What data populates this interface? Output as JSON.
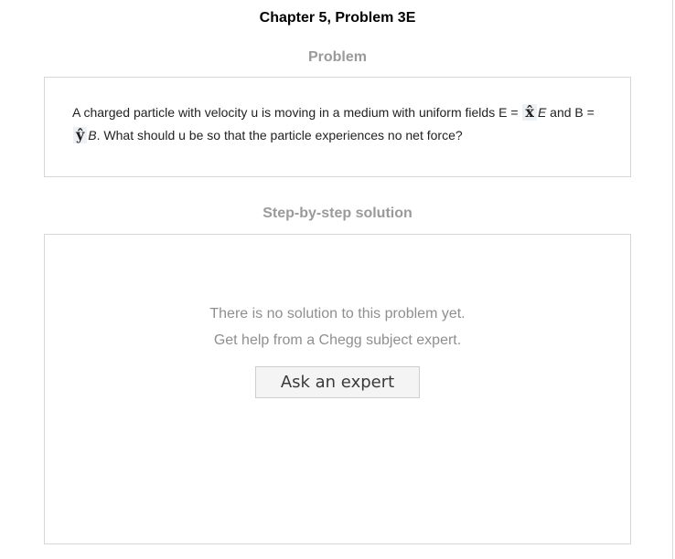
{
  "header": {
    "title": "Chapter 5, Problem 3E"
  },
  "problem": {
    "heading": "Problem",
    "text_part1": "A charged particle with velocity u is moving in a medium with uniform fields E =",
    "vec_x": "x̂",
    "sym_E": "E",
    "text_part2": "and B =",
    "vec_y": "ŷ",
    "sym_B": "B",
    "text_part3": ". What should u be so that the particle experiences no net force?"
  },
  "solution": {
    "heading": "Step-by-step solution",
    "empty_message": "There is no solution to this problem yet.",
    "help_message": "Get help from a Chegg subject expert.",
    "ask_button_label": "Ask an expert"
  },
  "colors": {
    "heading_gray": "#9a9a9a",
    "border": "#d6d6d6",
    "message_gray": "#8f8f8f",
    "button_bg": "#f4f4f4"
  }
}
